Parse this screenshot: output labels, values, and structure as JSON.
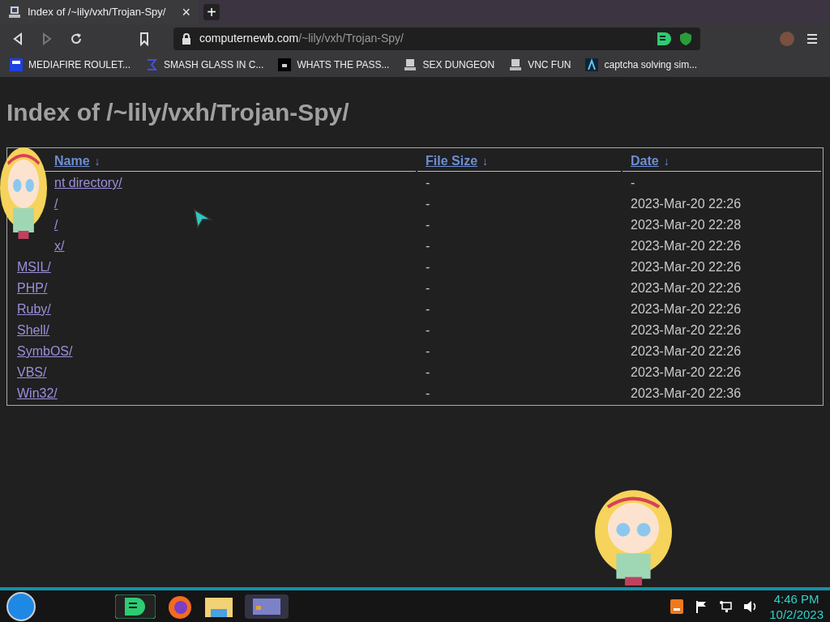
{
  "tab": {
    "title": "Index of /~lily/vxh/Trojan-Spy/",
    "close": "×",
    "new_tab": "+"
  },
  "address_bar": {
    "domain": "computernewb.com",
    "path": "/~lily/vxh/Trojan-Spy/"
  },
  "bookmarks": [
    "MEDIAFIRE ROULET...",
    "SMASH GLASS IN C...",
    "WHATS THE PASS...",
    "SEX DUNGEON",
    "VNC FUN",
    "captcha solving sim..."
  ],
  "heading": "Index of /~lily/vxh/Trojan-Spy/",
  "table": {
    "columns": [
      {
        "label": "Name",
        "sort": "↓"
      },
      {
        "label": "File Size",
        "sort": "↓"
      },
      {
        "label": "Date",
        "sort": "↓"
      }
    ],
    "rows": [
      {
        "name": "nt directory/",
        "covered": true,
        "size": "-",
        "date": "-"
      },
      {
        "name": "/",
        "covered": true,
        "size": "-",
        "date": "2023-Mar-20 22:26"
      },
      {
        "name": "/",
        "covered": true,
        "size": "-",
        "date": "2023-Mar-20 22:28"
      },
      {
        "name": "x/",
        "covered": true,
        "size": "-",
        "date": "2023-Mar-20 22:26"
      },
      {
        "name": "MSIL/",
        "covered": false,
        "size": "-",
        "date": "2023-Mar-20 22:26"
      },
      {
        "name": "PHP/",
        "covered": false,
        "size": "-",
        "date": "2023-Mar-20 22:26"
      },
      {
        "name": "Ruby/",
        "covered": false,
        "size": "-",
        "date": "2023-Mar-20 22:26"
      },
      {
        "name": "Shell/",
        "covered": false,
        "size": "-",
        "date": "2023-Mar-20 22:26"
      },
      {
        "name": "SymbOS/",
        "covered": false,
        "size": "-",
        "date": "2023-Mar-20 22:26"
      },
      {
        "name": "VBS/",
        "covered": false,
        "size": "-",
        "date": "2023-Mar-20 22:26"
      },
      {
        "name": "Win32/",
        "covered": false,
        "size": "-",
        "date": "2023-Mar-20 22:36"
      }
    ]
  },
  "taskbar": {
    "time": "4:46 PM",
    "date": "10/2/2023"
  }
}
